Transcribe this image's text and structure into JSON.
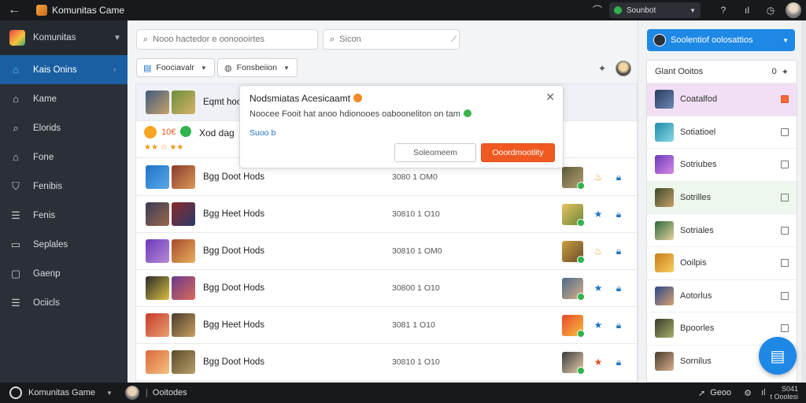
{
  "topbar": {
    "app_title": "Komunitas Came",
    "status_label": "Sounbot"
  },
  "sidebar": {
    "workspace": "Komunitas",
    "items": [
      {
        "label": "Kais Onins",
        "icon": "home-icon",
        "active": true
      },
      {
        "label": "Kame",
        "icon": "house-icon"
      },
      {
        "label": "Elorids",
        "icon": "search-icon"
      },
      {
        "label": "Fone",
        "icon": "house-icon"
      },
      {
        "label": "Fenibis",
        "icon": "shield-icon"
      },
      {
        "label": "Fenis",
        "icon": "list-icon"
      },
      {
        "label": "Seplales",
        "icon": "tray-icon"
      },
      {
        "label": "Gaenp",
        "icon": "square-icon"
      },
      {
        "label": "Ociicls",
        "icon": "list-icon"
      }
    ]
  },
  "search": {
    "main_placeholder": "Nooo hactedor e oonoooirtes",
    "secondary_placeholder": "Sicon"
  },
  "filters": [
    {
      "label": "Foociavalr",
      "icon": "tag-icon"
    },
    {
      "label": "Fonsbeiion",
      "icon": "profile-icon"
    }
  ],
  "list": {
    "first_row_name": "Eqmt hoo",
    "second_row_title": "Xod dag",
    "second_row_rating": "10€",
    "second_row_stars": "★★ ☆ ★★",
    "rows": [
      {
        "name": "Bgg Doot Hods",
        "code": "3080 1 OM0"
      },
      {
        "name": "Bgg Heet Hods",
        "code": "30810 1 O10"
      },
      {
        "name": "Bgg Doot Hods",
        "code": "30810 1 OM0"
      },
      {
        "name": "Bgg Doot Hods",
        "code": "30800 1 O10"
      },
      {
        "name": "Bgg Heet Hods",
        "code": "3081 1 O10"
      },
      {
        "name": "Bgg Doot Hods",
        "code": "30810 1 O10"
      }
    ]
  },
  "dialog": {
    "title": "Nodsmiatas Acesicaamt",
    "message": "Noocee Fooit hat anoo hdionooes oabooneliton on tam",
    "link": "Suoo b",
    "cancel_label": "Soleomeem",
    "ok_label": "Ooordmootlity"
  },
  "right_panel": {
    "top_button": "Soolentiof oolosattios",
    "list_header": "Glant Ooitos",
    "list_header_count": "0",
    "items": [
      {
        "label": "Coatalfod",
        "checked": true
      },
      {
        "label": "Sotiatioel",
        "checked": false
      },
      {
        "label": "Sotriubes",
        "checked": false
      },
      {
        "label": "Sotrilles",
        "checked": false
      },
      {
        "label": "Sotriales",
        "checked": false
      },
      {
        "label": "Ooilpis",
        "checked": false
      },
      {
        "label": "Aotorlus",
        "checked": false
      },
      {
        "label": "Bpoorles",
        "checked": false
      },
      {
        "label": "Sornilus",
        "checked": false
      }
    ]
  },
  "bottombar": {
    "title": "Komunitas Game",
    "channel": "Ooitodes",
    "right_label": "Geoo",
    "right_text_1": "S041",
    "right_text_2": "t Ooolesi"
  },
  "colors": {
    "accent": "#1e88e5",
    "sidebar_bg": "#2b3038",
    "active_bg": "#1b5fa3",
    "ok_button": "#f05a22"
  }
}
